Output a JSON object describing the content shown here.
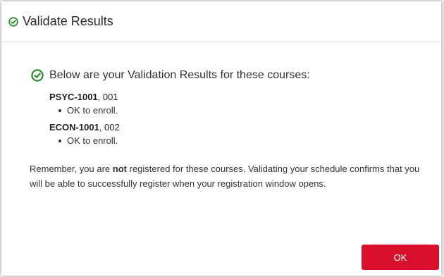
{
  "dialog": {
    "title": "Validate Results",
    "title_icon": "check-circle-icon",
    "intro_icon": "check-circle-icon",
    "intro": "Below are your Validation Results for these courses:",
    "courses": [
      {
        "code": "PSYC-1001",
        "section": ", 001",
        "status": "OK to enroll."
      },
      {
        "code": "ECON-1001",
        "section": ", 002",
        "status": "OK to enroll."
      }
    ],
    "note_before": "Remember, you are ",
    "note_emphasis": "not",
    "note_after": " registered for these courses. Validating your schedule confirms that you will be able to successfully register when your registration window opens.",
    "ok_label": "OK"
  },
  "colors": {
    "success_green": "#2e8b2e",
    "primary_red": "#d8102d"
  }
}
